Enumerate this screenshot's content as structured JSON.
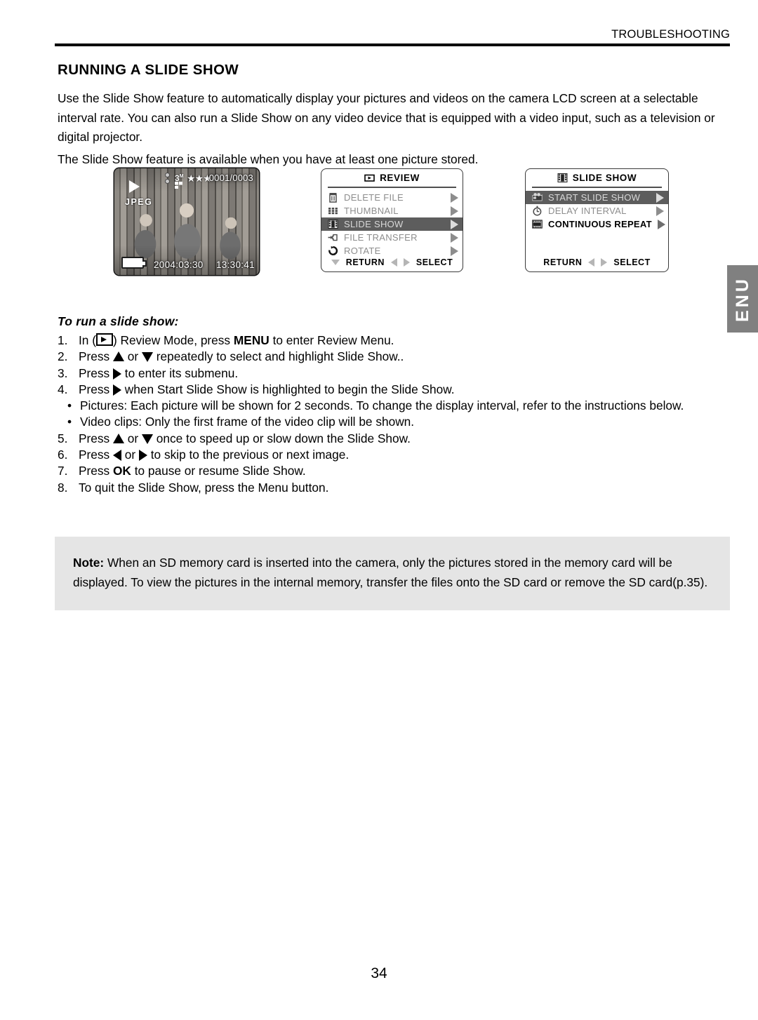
{
  "header": {
    "section_label": "TROUBLESHOOTING"
  },
  "page_title": "RUNNING A SLIDE SHOW",
  "intro": {
    "paragraph_1": "Use the Slide Show feature to automatically display your pictures and videos on the camera LCD screen at a selectable interval rate. You can also run a Slide Show on any video device that is equipped with a video input, such as a television or digital projector.",
    "paragraph_2": "The Slide Show feature is available when you have at least one picture stored."
  },
  "lcd_preview": {
    "mode_icon": "play-icon",
    "file_format": "JPEG",
    "resolution": "3",
    "resolution_unit": "M",
    "quality_stars": "★★★",
    "counter": "0001/0003",
    "date": "2004:03:30",
    "time": "13:30:41",
    "battery_icon": "battery-full-icon"
  },
  "review_menu": {
    "title": "REVIEW",
    "title_icon": "play-box-icon",
    "items": [
      {
        "label": "DELETE FILE",
        "icon": "trash-icon",
        "selected": false
      },
      {
        "label": "THUMBNAIL",
        "icon": "grid-icon",
        "selected": false
      },
      {
        "label": "SLIDE SHOW",
        "icon": "filmstrip-icon",
        "selected": true
      },
      {
        "label": "FILE TRANSFER",
        "icon": "transfer-icon",
        "selected": false
      },
      {
        "label": "ROTATE",
        "icon": "rotate-icon",
        "selected": false
      }
    ],
    "footer": {
      "return_label": "RETURN",
      "select_label": "SELECT"
    }
  },
  "slide_show_menu": {
    "title": "SLIDE SHOW",
    "title_icon": "filmstrip-icon",
    "items": [
      {
        "label": "START SLIDE SHOW",
        "icon": "projector-icon",
        "selected": true,
        "bold": false
      },
      {
        "label": "DELAY INTERVAL",
        "icon": "stopwatch-icon",
        "selected": false,
        "bold": false
      },
      {
        "label": "CONTINUOUS REPEAT",
        "icon": "filmroll-icon",
        "selected": false,
        "bold": true
      }
    ],
    "footer": {
      "return_label": "RETURN",
      "select_label": "SELECT"
    }
  },
  "side_tab": {
    "label": "ENU",
    "color": "#808080"
  },
  "procedure": {
    "heading": "To run a slide show:",
    "steps": [
      {
        "num": "1.",
        "kind": "numbered",
        "text_before": "In (",
        "glyph": "play-box-icon",
        "text_after": ") Review Mode, press ",
        "bold_word": "MENU",
        "text_tail": " to enter Review Menu."
      },
      {
        "num": "2.",
        "kind": "numbered",
        "text_before": "Press ",
        "glyph": "up-arrow-icon",
        "text_mid": " or ",
        "glyph2": "down-arrow-icon",
        "text_after": " repeatedly to select and highlight Slide Show.."
      },
      {
        "num": "3.",
        "kind": "numbered",
        "text_before": "Press ",
        "glyph": "right-arrow-icon",
        "text_after": " to enter its submenu."
      },
      {
        "num": "4.",
        "kind": "numbered",
        "text_before": "Press ",
        "glyph": "right-arrow-icon",
        "text_after": " when Start Slide Show is highlighted to begin the Slide Show."
      },
      {
        "num": "•",
        "kind": "bullet",
        "text": "Pictures: Each picture will be shown for 2 seconds. To change the display interval, refer to the instructions below."
      },
      {
        "num": "•",
        "kind": "bullet",
        "text": "Video clips: Only the first frame of the video clip will be shown."
      },
      {
        "num": "5.",
        "kind": "numbered",
        "text_before": "Press ",
        "glyph": "up-arrow-icon",
        "text_mid": " or ",
        "glyph2": "down-arrow-icon",
        "text_after": " once to speed up or slow down the Slide Show."
      },
      {
        "num": "6.",
        "kind": "numbered",
        "text_before": "Press ",
        "glyph": "left-arrow-icon",
        "text_mid": " or ",
        "glyph2": "right-arrow-icon",
        "text_after": " to skip to the previous or next image."
      },
      {
        "num": "7.",
        "kind": "numbered",
        "text_before": "Press ",
        "bold_word": "OK",
        "text_after": " to pause or resume Slide Show."
      },
      {
        "num": "8.",
        "kind": "numbered",
        "text": "To quit the Slide Show, press the Menu button."
      }
    ]
  },
  "note": {
    "label": "Note:",
    "text": " When an SD memory card is inserted into the camera, only the pictures stored in the memory card will be displayed. To view the pictures in the internal memory, transfer the files onto the SD card or remove the SD card(p.35)."
  },
  "page_number": "34"
}
